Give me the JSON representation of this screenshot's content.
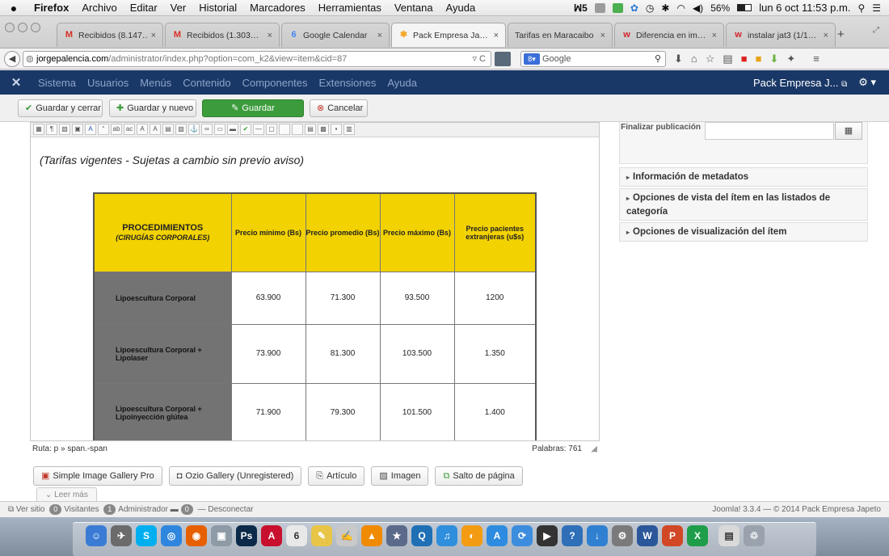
{
  "menubar": {
    "app": "Firefox",
    "items": [
      "Archivo",
      "Editar",
      "Ver",
      "Historial",
      "Marcadores",
      "Herramientas",
      "Ventana",
      "Ayuda"
    ],
    "adobe_count": "5",
    "battery": "56%",
    "clock": "lun 6 oct  11:53 p.m."
  },
  "tabs": [
    {
      "label": "Recibidos (8.147…",
      "icon": "gmail-icon",
      "color": "#d93025",
      "glyph": "M",
      "active": false
    },
    {
      "label": "Recibidos (1.303…",
      "icon": "gmail-icon",
      "color": "#d93025",
      "glyph": "M",
      "active": false
    },
    {
      "label": "Google Calendar",
      "icon": "calendar-icon",
      "color": "#4285f4",
      "glyph": "6",
      "active": false
    },
    {
      "label": "Pack Empresa Ja…",
      "icon": "joomla-icon",
      "color": "#f5a623",
      "glyph": "✱",
      "active": true
    },
    {
      "label": "Tarifas en Maracaibo",
      "icon": "",
      "color": "",
      "glyph": "",
      "active": false
    },
    {
      "label": "Diferencia en im…",
      "icon": "w-icon",
      "color": "#d2232a",
      "glyph": "w",
      "active": false
    },
    {
      "label": "instalar jat3 (1/1…",
      "icon": "w-icon",
      "color": "#d2232a",
      "glyph": "w",
      "active": false
    }
  ],
  "nav": {
    "url_host": "jorgepalencia.com",
    "url_path": "/administrator/index.php?option=com_k2&view=item&cid=87",
    "search_placeholder": "Google"
  },
  "joomla": {
    "menu": [
      "Sistema",
      "Usuarios",
      "Menús",
      "Contenido",
      "Componentes",
      "Extensiones",
      "Ayuda"
    ],
    "site_name": "Pack Empresa J...",
    "toolbar": {
      "save_close": "Guardar y cerrar",
      "save_new": "Guardar y nuevo",
      "save": "Guardar",
      "cancel": "Cancelar"
    }
  },
  "editor": {
    "note": "(Tarifas vigentes - Sujetas a cambio sin previo aviso)",
    "table": {
      "header_proc": "PROCEDIMIENTOS",
      "header_proc_sub": "(CIRUGÍAS CORPORALES)",
      "headers": [
        "Precio mínimo (Bs)",
        "Precio promedio (Bs)",
        "Precio máximo (Bs)",
        "Precio pacientes extranjeras (u$s)"
      ],
      "rows": [
        {
          "proc": "Lipoescultura Corporal",
          "min": "63.900",
          "avg": "71.300",
          "max": "93.500",
          "ext": "1200"
        },
        {
          "proc": "Lipoescultura Corporal + Lipolaser",
          "min": "73.900",
          "avg": "81.300",
          "max": "103.500",
          "ext": "1.350"
        },
        {
          "proc": "Lipoescultura Corporal + Lipoinyección glútea",
          "min": "71.900",
          "avg": "79.300",
          "max": "101.500",
          "ext": "1.400"
        }
      ]
    },
    "path": "Ruta:  p » span.-span",
    "words": "Palabras: 761",
    "buttons": {
      "gallery": "Simple Image Gallery Pro",
      "ozio": "Ozio Gallery (Unregistered)",
      "article": "Artículo",
      "image": "Imagen",
      "pagebreak": "Salto de página",
      "readmore": "Leer más"
    }
  },
  "sidebar": {
    "finalize_label": "Finalizar publicación",
    "sections": [
      "Información de metadatos",
      "Opciones de vista del ítem en las listados de categoría",
      "Opciones de visualización del ítem"
    ]
  },
  "status": {
    "view_site": "Ver sitio",
    "visitors_count": "0",
    "visitors": "Visitantes",
    "admin_count": "1",
    "admin": "Administrador",
    "msg_count": "0",
    "logout": "Desconectar",
    "footer": "Joomla! 3.3.4  —  © 2014 Pack Empresa Japeto"
  },
  "dock": {
    "apps": [
      {
        "name": "finder-icon",
        "color": "#3a7bd5",
        "glyph": "☺"
      },
      {
        "name": "rocket-icon",
        "color": "#6b6b6b",
        "glyph": "✈"
      },
      {
        "name": "skype-icon",
        "color": "#00aff0",
        "glyph": "S"
      },
      {
        "name": "safari-icon",
        "color": "#2e86de",
        "glyph": "◎"
      },
      {
        "name": "firefox-icon",
        "color": "#e66000",
        "glyph": "◉"
      },
      {
        "name": "preview-icon",
        "color": "#8e9aa6",
        "glyph": "▣"
      },
      {
        "name": "photoshop-icon",
        "color": "#0b2a4a",
        "glyph": "Ps"
      },
      {
        "name": "acrobat-icon",
        "color": "#c8102e",
        "glyph": "A"
      },
      {
        "name": "calendar-icon",
        "color": "#e8e8e8",
        "glyph": "6"
      },
      {
        "name": "notes-icon",
        "color": "#e8c547",
        "glyph": "✎"
      },
      {
        "name": "textedit-icon",
        "color": "#c9c9c9",
        "glyph": "✍"
      },
      {
        "name": "vlc-icon",
        "color": "#f08a00",
        "glyph": "▲"
      },
      {
        "name": "imovie-icon",
        "color": "#5b6a8a",
        "glyph": "★"
      },
      {
        "name": "quicktime-icon",
        "color": "#1f6fb5",
        "glyph": "Q"
      },
      {
        "name": "itunes-icon",
        "color": "#2f8fdc",
        "glyph": "♫"
      },
      {
        "name": "ibooks-icon",
        "color": "#f39c12",
        "glyph": "◐"
      },
      {
        "name": "appstore-icon",
        "color": "#2d8ce0",
        "glyph": "A"
      },
      {
        "name": "sync-icon",
        "color": "#3c8dde",
        "glyph": "⟳"
      },
      {
        "name": "clapper-icon",
        "color": "#333333",
        "glyph": "▶"
      },
      {
        "name": "dictionary-icon",
        "color": "#2e6fb8",
        "glyph": "?"
      },
      {
        "name": "download-icon",
        "color": "#2f80d1",
        "glyph": "↓"
      },
      {
        "name": "sysprefs-icon",
        "color": "#7a7a7a",
        "glyph": "⚙"
      },
      {
        "name": "word-icon",
        "color": "#2b579a",
        "glyph": "W"
      },
      {
        "name": "powerpoint-icon",
        "color": "#d24726",
        "glyph": "P"
      },
      {
        "name": "excel-icon",
        "color": "#1e9e4a",
        "glyph": "X"
      },
      {
        "name": "document-icon",
        "color": "#d9d9d9",
        "glyph": "▤"
      },
      {
        "name": "trash-icon",
        "color": "#9aa3ad",
        "glyph": "♲"
      }
    ]
  }
}
